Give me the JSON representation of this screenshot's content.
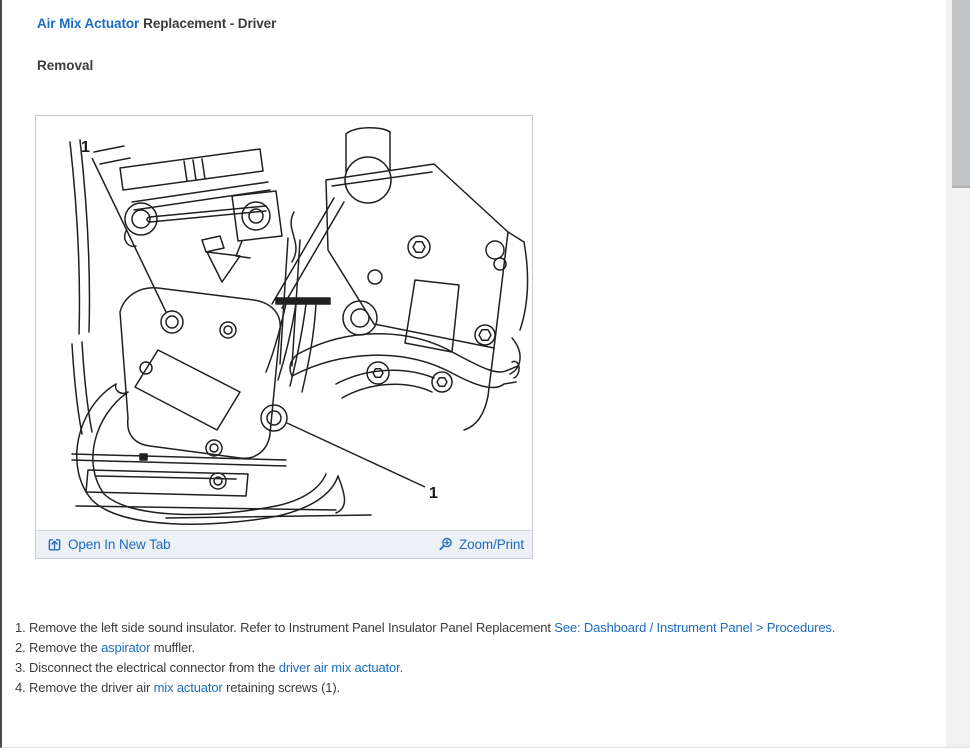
{
  "page": {
    "title_link": "Air Mix Actuator",
    "title_rest": "Replacement - Driver",
    "section_heading": "Removal"
  },
  "figure": {
    "open_in_new_tab": "Open In New Tab",
    "zoom_print": "Zoom/Print",
    "callout_top": "1",
    "callout_bottom": "1"
  },
  "colors": {
    "link_blue": "#1c6cc2",
    "text_dark": "#3c3c3c",
    "figure_bar_bg": "#edf0f4"
  },
  "steps": [
    {
      "number": "1.",
      "segments": [
        {
          "text": "Remove the left side sound insulator. Refer to Instrument Panel Insulator Panel Replacement ",
          "link": false
        },
        {
          "text": "See: Dashboard / Instrument Panel > Procedures.",
          "link": true
        }
      ]
    },
    {
      "number": "2.",
      "segments": [
        {
          "text": "Remove the ",
          "link": false
        },
        {
          "text": "aspirator",
          "link": true
        },
        {
          "text": " muffler.",
          "link": false
        }
      ]
    },
    {
      "number": "3.",
      "segments": [
        {
          "text": "Disconnect the electrical connector from the ",
          "link": false
        },
        {
          "text": "driver air mix actuator.",
          "link": true
        }
      ]
    },
    {
      "number": "4.",
      "segments": [
        {
          "text": "Remove the driver air ",
          "link": false
        },
        {
          "text": "mix actuator",
          "link": true
        },
        {
          "text": " retaining screws (1).",
          "link": false
        }
      ]
    }
  ]
}
